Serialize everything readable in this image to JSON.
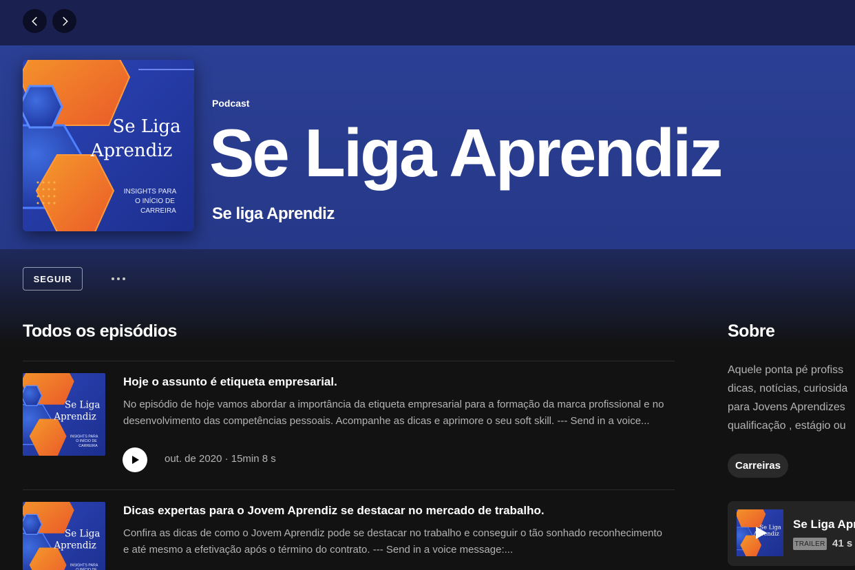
{
  "nav": {
    "back_label": "Voltar",
    "forward_label": "Avançar"
  },
  "podcast": {
    "type_label": "Podcast",
    "title": "Se Liga Aprendiz",
    "publisher": "Se liga Aprendiz",
    "cover": {
      "title_line1": "Se Liga",
      "title_line2": "Aprendiz",
      "tagline_line1": "INSIGHTS PARA",
      "tagline_line2": "O INÍCIO DE",
      "tagline_line3": "CARREIRA"
    }
  },
  "actions": {
    "follow_label": "SEGUIR",
    "more_label": "..."
  },
  "episodes_section": {
    "title": "Todos os episódios",
    "episodes": [
      {
        "title": "Hoje o assunto é etiqueta empresarial.",
        "description_line1": "No episódio de hoje vamos abordar a importância da etiqueta empresarial para a formação da marca profissional e no",
        "description_line2": "desenvolvimento das competências pessoais.  Acompanhe as dicas e aprimore o seu soft skill.  --- Send in a voice...",
        "meta": "out. de 2020 · 15min 8 s"
      },
      {
        "title": "Dicas expertas para o Jovem Aprendiz se destacar no mercado de trabalho.",
        "description_line1": "Confira as dicas de como o Jovem Aprendiz pode se destacar no  trabalho e conseguir o tão sonhado reconhecimento",
        "description_line2": "e até mesmo a efetivação após o término do contrato. --- Send in a voice message:..."
      }
    ]
  },
  "about": {
    "title": "Sobre",
    "lines": [
      "Aquele ponta pé profiss",
      "dicas, notícias, curiosida",
      "para Jovens Aprendizes",
      "qualificação , estágio ou"
    ],
    "category": "Carreiras"
  },
  "trailer": {
    "title": "Se Liga Apr",
    "badge": "TRAILER",
    "duration": "41 s"
  },
  "colors": {
    "hero_blue": "#2b3f94",
    "cover_orange": "#f26a2b",
    "background": "#121212"
  }
}
